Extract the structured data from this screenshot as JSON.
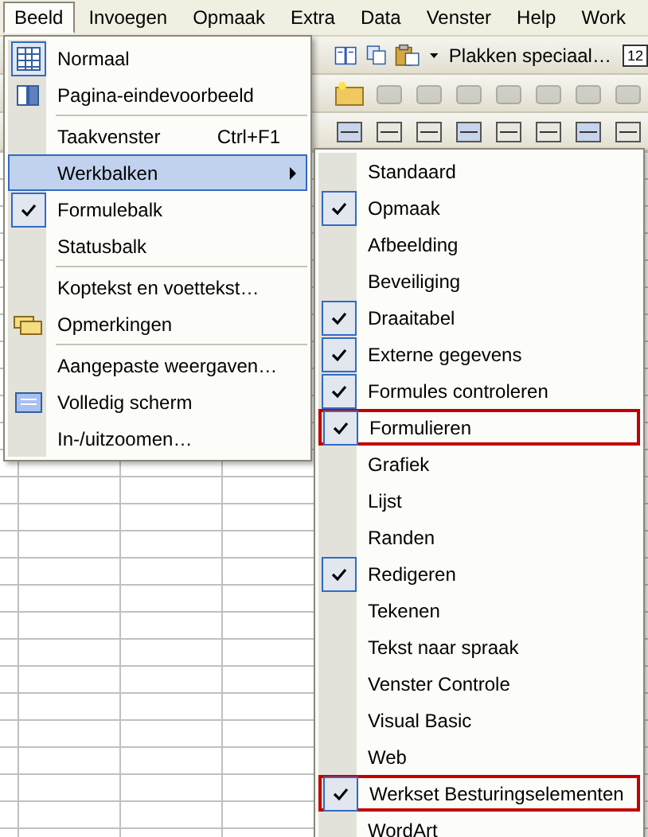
{
  "menubar": [
    {
      "label": "Beeld",
      "selected": true
    },
    {
      "label": "Invoegen",
      "selected": false
    },
    {
      "label": "Opmaak",
      "selected": false
    },
    {
      "label": "Extra",
      "selected": false
    },
    {
      "label": "Data",
      "selected": false
    },
    {
      "label": "Venster",
      "selected": false
    },
    {
      "label": "Help",
      "selected": false
    },
    {
      "label": "Work",
      "selected": false
    }
  ],
  "toolbar": {
    "paste_special": "Plakken speciaal…",
    "calendar_day": "12"
  },
  "view_menu": {
    "items": [
      {
        "kind": "item",
        "label": "Normaal",
        "checked": true,
        "selected": false
      },
      {
        "kind": "item",
        "label": "Pagina-eindevoorbeeld",
        "checked": false,
        "selected": false
      },
      {
        "kind": "separator"
      },
      {
        "kind": "item",
        "label": "Taakvenster",
        "shortcut": "Ctrl+F1",
        "checked": false,
        "selected": false
      },
      {
        "kind": "submenu",
        "label": "Werkbalken",
        "checked": false,
        "selected": true
      },
      {
        "kind": "item",
        "label": "Formulebalk",
        "checked": true,
        "selected": false
      },
      {
        "kind": "item",
        "label": "Statusbalk",
        "checked": false,
        "selected": false
      },
      {
        "kind": "separator"
      },
      {
        "kind": "item",
        "label": "Koptekst en voettekst…",
        "checked": false,
        "selected": false
      },
      {
        "kind": "item",
        "label": "Opmerkingen",
        "checked": false,
        "selected": false
      },
      {
        "kind": "separator"
      },
      {
        "kind": "item",
        "label": "Aangepaste weergaven…",
        "checked": false,
        "selected": false
      },
      {
        "kind": "item",
        "label": "Volledig scherm",
        "checked": false,
        "selected": false
      },
      {
        "kind": "item",
        "label": "In-/uitzoomen…",
        "checked": false,
        "selected": false
      }
    ]
  },
  "toolbars_menu": {
    "items": [
      {
        "label": "Standaard",
        "checked": false,
        "outlined": false
      },
      {
        "label": "Opmaak",
        "checked": true,
        "outlined": false
      },
      {
        "label": "Afbeelding",
        "checked": false,
        "outlined": false
      },
      {
        "label": "Beveiliging",
        "checked": false,
        "outlined": false
      },
      {
        "label": "Draaitabel",
        "checked": true,
        "outlined": false
      },
      {
        "label": "Externe gegevens",
        "checked": true,
        "outlined": false
      },
      {
        "label": "Formules controleren",
        "checked": true,
        "outlined": false
      },
      {
        "label": "Formulieren",
        "checked": true,
        "outlined": true
      },
      {
        "label": "Grafiek",
        "checked": false,
        "outlined": false
      },
      {
        "label": "Lijst",
        "checked": false,
        "outlined": false
      },
      {
        "label": "Randen",
        "checked": false,
        "outlined": false
      },
      {
        "label": "Redigeren",
        "checked": true,
        "outlined": false
      },
      {
        "label": "Tekenen",
        "checked": false,
        "outlined": false
      },
      {
        "label": "Tekst naar spraak",
        "checked": false,
        "outlined": false
      },
      {
        "label": "Venster Controle",
        "checked": false,
        "outlined": false
      },
      {
        "label": "Visual Basic",
        "checked": false,
        "outlined": false
      },
      {
        "label": "Web",
        "checked": false,
        "outlined": false
      },
      {
        "label": "Werkset Besturingselementen",
        "checked": true,
        "outlined": true
      },
      {
        "label": "WordArt",
        "checked": false,
        "outlined": false
      }
    ]
  }
}
